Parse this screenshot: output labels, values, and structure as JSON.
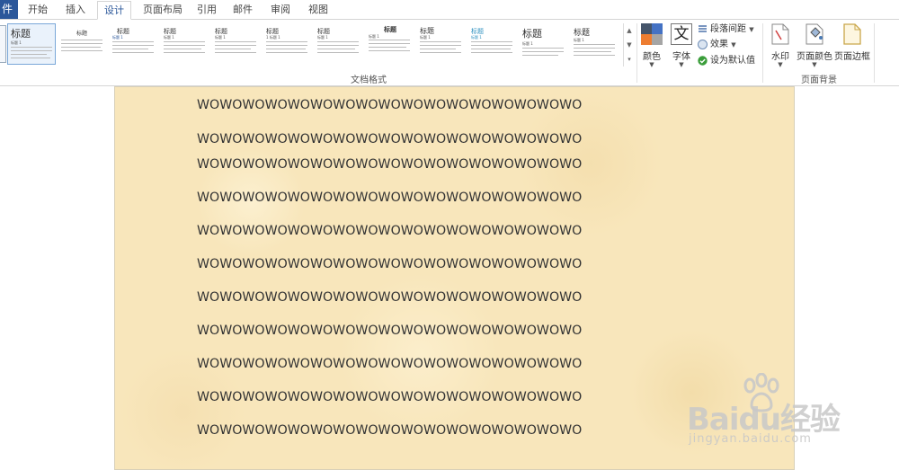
{
  "tabs": [
    {
      "label": "件",
      "active": false
    },
    {
      "label": "开始",
      "active": false
    },
    {
      "label": "插入",
      "active": false
    },
    {
      "label": "设计",
      "active": true
    },
    {
      "label": "页面布局",
      "active": false
    },
    {
      "label": "引用",
      "active": false
    },
    {
      "label": "邮件",
      "active": false
    },
    {
      "label": "审阅",
      "active": false
    },
    {
      "label": "视图",
      "active": false
    }
  ],
  "ribbon": {
    "styles_gallery": {
      "group_label": "文档格式",
      "thumbnails": [
        {
          "title": "标题",
          "subtitle": "标题 1"
        },
        {
          "title": "标题",
          "subtitle": ""
        },
        {
          "title": "标题",
          "subtitle": "标题 1"
        },
        {
          "title": "标题",
          "subtitle": "标题 1"
        },
        {
          "title": "标题",
          "subtitle": "标题 1"
        },
        {
          "title": "标题",
          "subtitle": "1 标题 1"
        },
        {
          "title": "标题",
          "subtitle": "标题 1"
        },
        {
          "title": "标题",
          "subtitle": "标题 1"
        },
        {
          "title": "标题",
          "subtitle": "标题 1"
        },
        {
          "title": "标题",
          "subtitle": "标题 1"
        },
        {
          "title": "标题",
          "subtitle": "标题 1"
        },
        {
          "title": "标题",
          "subtitle": "标题 1"
        }
      ]
    },
    "colors_label": "颜色",
    "fonts_label": "字体",
    "fonts_icon_glyph": "文",
    "paragraph_spacing_label": "段落间距",
    "effects_label": "效果",
    "set_default_label": "设为默认值",
    "page_background": {
      "group_label": "页面背景",
      "watermark_label": "水印",
      "page_color_label": "页面颜色",
      "page_border_label": "页面边框"
    }
  },
  "document": {
    "lines": [
      "WOWOWOWOWOWOWOWOWOWOWOWOWOWOWOWOWO",
      "WOWOWOWOWOWOWOWOWOWOWOWOWOWOWOWOWO",
      "WOWOWOWOWOWOWOWOWOWOWOWOWOWOWOWOWO",
      "WOWOWOWOWOWOWOWOWOWOWOWOWOWOWOWOWO",
      "WOWOWOWOWOWOWOWOWOWOWOWOWOWOWOWOWO",
      "WOWOWOWOWOWOWOWOWOWOWOWOWOWOWOWOWO",
      "WOWOWOWOWOWOWOWOWOWOWOWOWOWOWOWOWO",
      "WOWOWOWOWOWOWOWOWOWOWOWOWOWOWOWOWO",
      "WOWOWOWOWOWOWOWOWOWOWOWOWOWOWOWOWO",
      "WOWOWOWOWOWOWOWOWOWOWOWOWOWOWOWOWO",
      "WOWOWOWOWOWOWOWOWOWOWOWOWOWOWOWOWO"
    ],
    "page_color": "#f8e6bb"
  },
  "watermark": {
    "brand": "Baidu经验",
    "url": "jingyan.baidu.com"
  },
  "colors": {
    "accent": "#2b579a",
    "text": "#333333"
  }
}
